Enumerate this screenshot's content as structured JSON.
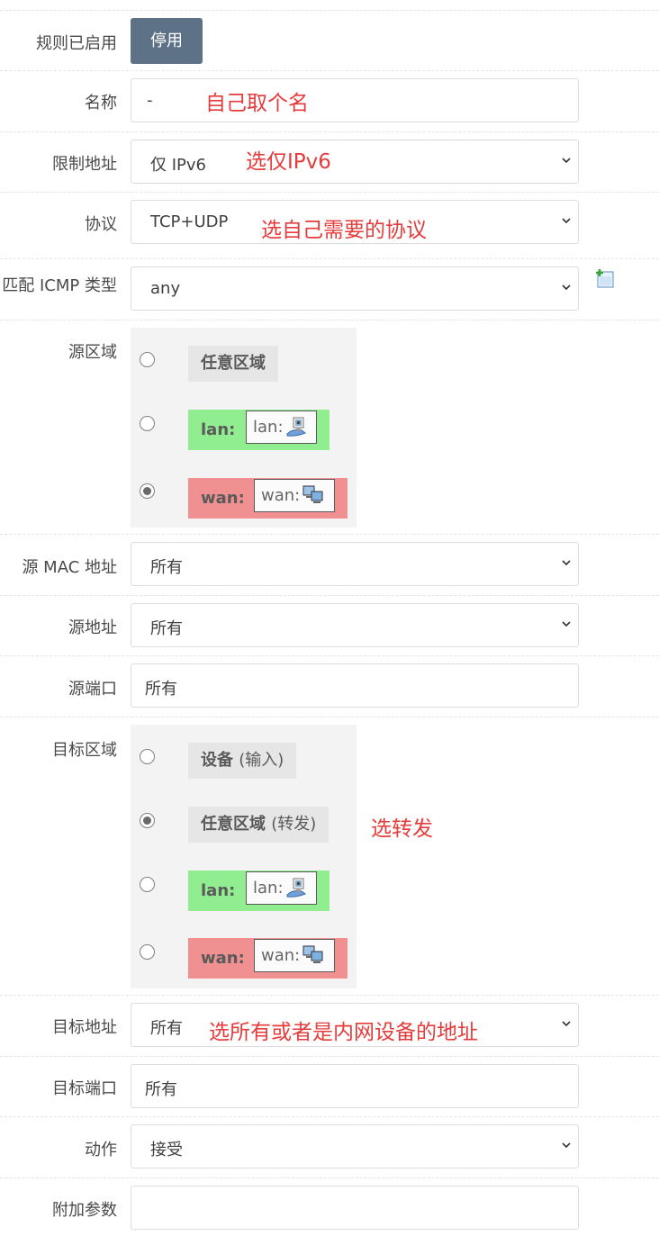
{
  "rule_enabled": {
    "label": "规则已启用",
    "button": "停用"
  },
  "name": {
    "label": "名称",
    "value": "-",
    "annotation": "自己取个名"
  },
  "restrict_address": {
    "label": "限制地址",
    "value": "仅 IPv6",
    "annotation": "选仅IPv6"
  },
  "protocol": {
    "label": "协议",
    "value": "TCP+UDP",
    "annotation": "选自己需要的协议"
  },
  "icmp_type": {
    "label": "匹配 ICMP 类型",
    "value": "any"
  },
  "source_zone": {
    "label": "源区域",
    "options": [
      {
        "name": "任意区域",
        "selected": false
      },
      {
        "name": "lan:",
        "device": "lan:",
        "selected": false
      },
      {
        "name": "wan:",
        "device": "wan:",
        "selected": true
      }
    ]
  },
  "source_mac": {
    "label": "源 MAC 地址",
    "value": "所有"
  },
  "source_address": {
    "label": "源地址",
    "value": "所有"
  },
  "source_port": {
    "label": "源端口",
    "value": "所有"
  },
  "dest_zone": {
    "label": "目标区域",
    "annotation": "选转发",
    "options": [
      {
        "name": "设备",
        "extra": "(输入)",
        "selected": false
      },
      {
        "name": "任意区域",
        "extra": "(转发)",
        "selected": true
      },
      {
        "name": "lan:",
        "device": "lan:",
        "selected": false
      },
      {
        "name": "wan:",
        "device": "wan:",
        "selected": false
      }
    ]
  },
  "dest_address": {
    "label": "目标地址",
    "value": "所有",
    "annotation": "选所有或者是内网设备的地址"
  },
  "dest_port": {
    "label": "目标端口",
    "value": "所有"
  },
  "action": {
    "label": "动作",
    "value": "接受"
  },
  "extra_args": {
    "label": "附加参数",
    "value": ""
  },
  "colors": {
    "lan": "#90ee90",
    "wan": "#f09090",
    "annotation": "#e63b3b",
    "button": "#5d7286"
  }
}
